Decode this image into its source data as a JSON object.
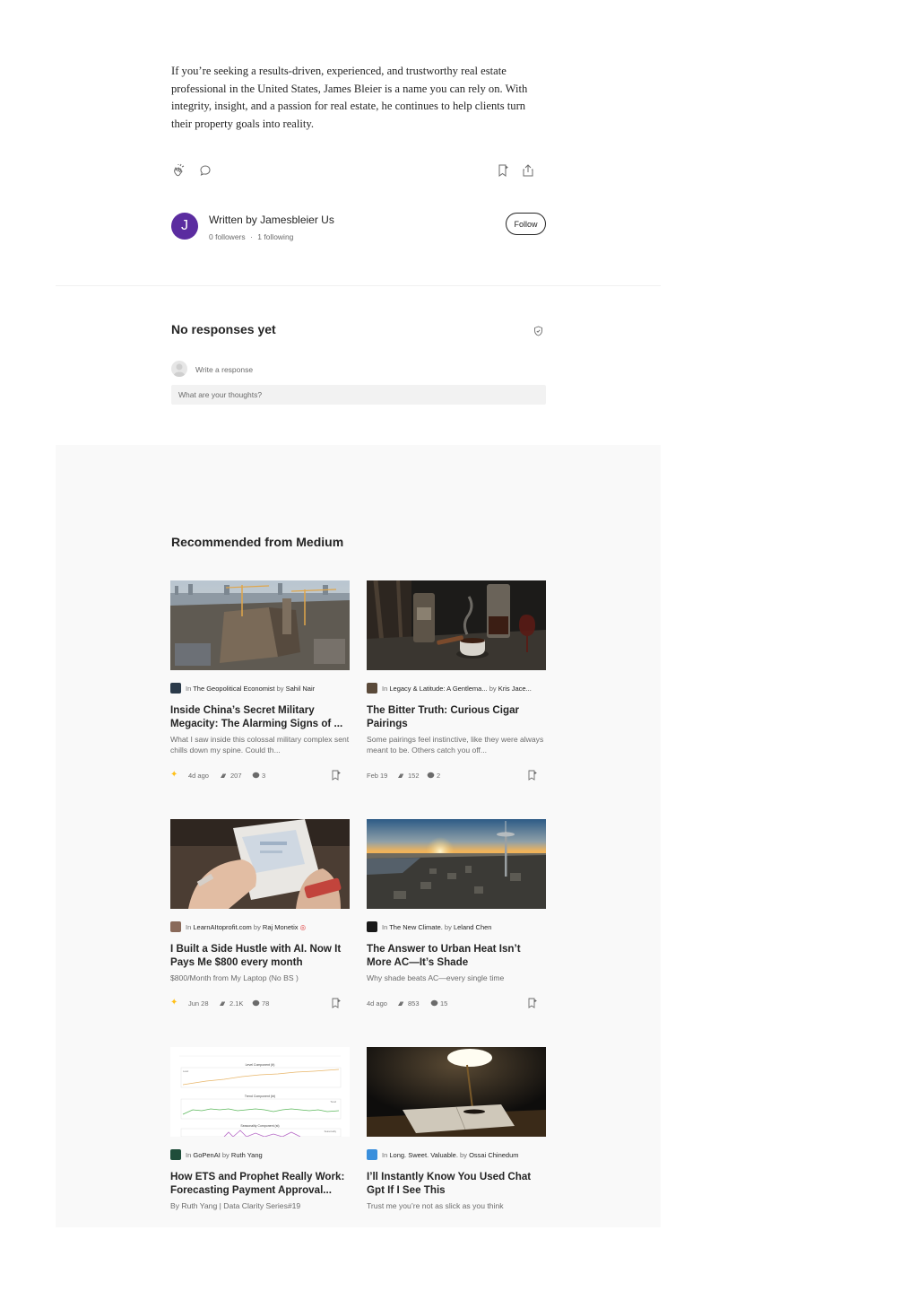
{
  "article": {
    "closing_paragraph": "If you’re seeking a results-driven, experienced, and trustworthy real estate professional in the United States, James Bleier is a name you can rely on. With integrity, insight, and a passion for real estate, he continues to help clients turn their property goals into reality."
  },
  "author": {
    "avatar_letter": "J",
    "written_by": "Written by Jamesbleier Us",
    "followers": "0 followers",
    "separator": "·",
    "following": "1 following",
    "follow_label": "Follow"
  },
  "responses": {
    "title": "No responses yet",
    "write_label": "Write a response",
    "placeholder": "What are your thoughts?"
  },
  "recommended": {
    "title": "Recommended from Medium",
    "in_word": "In",
    "by_word": "by",
    "cards": [
      {
        "publication": "The Geopolitical Economist",
        "author": "Sahil Nair",
        "title": "Inside China’s Secret Military Megacity: The Alarming Signs of ...",
        "subtitle": "What I saw inside this colossal military complex sent chills down my spine. Could th...",
        "date": "4d ago",
        "claps": "207",
        "comments": "3",
        "member_only": true
      },
      {
        "publication": "Legacy & Latitude: A Gentlema...",
        "author": "Kris Jace...",
        "title": "The Bitter Truth: Curious Cigar Pairings",
        "subtitle": "Some pairings feel instinctive, like they were always meant to be. Others catch you off...",
        "date": "Feb 19",
        "claps": "152",
        "comments": "2",
        "member_only": false
      },
      {
        "publication": "LearnAItoprofit.com",
        "author": "Raj Monetix",
        "title": "I Built a Side Hustle with AI. Now It Pays Me $800 every month",
        "subtitle": "$800/Month from My Laptop (No BS )",
        "date": "Jun 28",
        "claps": "2.1K",
        "comments": "78",
        "member_only": true
      },
      {
        "publication": "The New Climate.",
        "author": "Leland Chen",
        "title": "The Answer to Urban Heat Isn’t More AC—It’s Shade",
        "subtitle": "Why shade beats AC—every single time",
        "date": "4d ago",
        "claps": "853",
        "comments": "15",
        "member_only": false
      },
      {
        "publication": "GoPenAI",
        "author": "Ruth Yang",
        "title": "How ETS and Prophet Really Work: Forecasting Payment Approval...",
        "subtitle": "By Ruth Yang | Data Clarity Series#19"
      },
      {
        "publication": "Long. Sweet. Valuable.",
        "author": "Ossai Chinedum",
        "title": "I’ll Instantly Know You Used Chat Gpt If I See This",
        "subtitle": "Trust me you’re not as slick as you think"
      }
    ]
  },
  "thumbnail_chart": {
    "panel_titles": [
      "Level Component (ℓt)",
      "Trend Component (bt)",
      "Seasonality Component (st)"
    ],
    "legends": [
      "Level",
      "Trend",
      "Seasonality"
    ]
  },
  "colors": {
    "avatar": "#5b2ca0",
    "member_star": "#ffc017",
    "section_bg": "#f9f9f9",
    "text": "#242424",
    "muted": "#6b6b6b"
  },
  "icons": [
    "clap-icon",
    "comment-icon",
    "bookmark-icon",
    "share-icon",
    "shield-icon",
    "star-icon"
  ]
}
